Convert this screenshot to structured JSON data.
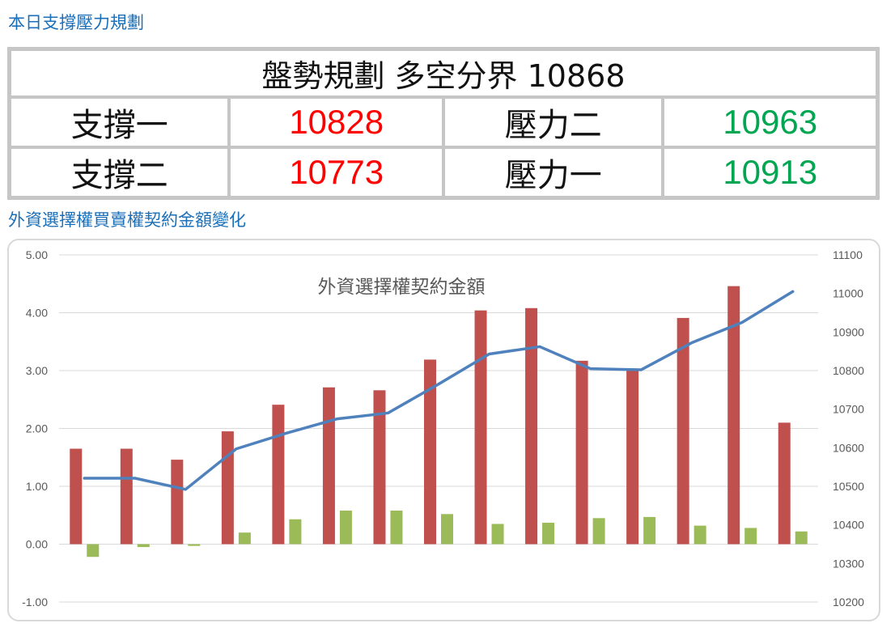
{
  "header": {
    "title": "本日支撐壓力規劃"
  },
  "plan": {
    "heading": "盤勢規劃 多空分界 10868",
    "rows": [
      {
        "label_left": "支撐一",
        "value_left": "10828",
        "label_right": "壓力二",
        "value_right": "10963"
      },
      {
        "label_left": "支撐二",
        "value_left": "10773",
        "label_right": "壓力一",
        "value_right": "10913"
      }
    ],
    "colors": {
      "support": "#ff0000",
      "pressure": "#00a651"
    }
  },
  "section2": {
    "title": "外資選擇權買賣權契約金額變化"
  },
  "chart_data": {
    "type": "bar",
    "title": "外資選擇權契約金額",
    "categories": [
      "",
      "",
      "",
      "",
      "",
      "",
      "",
      "",
      "",
      "",
      "",
      "",
      "",
      "",
      ""
    ],
    "series": [
      {
        "axis": "left",
        "type": "bar",
        "color": "#c0504d",
        "values": [
          1.65,
          1.65,
          1.46,
          1.95,
          2.41,
          2.71,
          2.66,
          3.19,
          4.04,
          4.08,
          3.17,
          3.01,
          3.91,
          4.46,
          2.1
        ]
      },
      {
        "axis": "left",
        "type": "bar",
        "color": "#9bbb59",
        "values": [
          -0.22,
          -0.05,
          -0.03,
          0.2,
          0.43,
          0.58,
          0.58,
          0.52,
          0.35,
          0.37,
          0.45,
          0.47,
          0.32,
          0.28,
          0.22
        ]
      },
      {
        "axis": "right",
        "type": "line",
        "color": "#4f81bd",
        "values": [
          10521,
          10521,
          10492,
          10597,
          10638,
          10675,
          10690,
          10765,
          10843,
          10862,
          10805,
          10802,
          10872,
          10925,
          11005
        ]
      }
    ],
    "y_left": {
      "min": -1,
      "max": 5,
      "ticks": [
        "-1.00",
        "0.00",
        "1.00",
        "2.00",
        "3.00",
        "4.00",
        "5.00"
      ]
    },
    "y_right": {
      "min": 10200,
      "max": 11100,
      "ticks": [
        "10200",
        "10300",
        "10400",
        "10500",
        "10600",
        "10700",
        "10800",
        "10900",
        "11000",
        "11100"
      ]
    },
    "grid": true,
    "legend": "none"
  }
}
